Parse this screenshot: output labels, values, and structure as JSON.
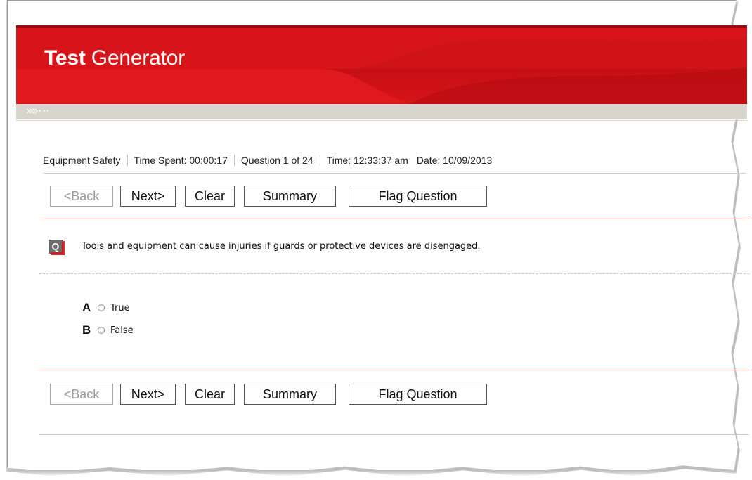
{
  "app": {
    "title_bold": "Test",
    "title_light": " Generator"
  },
  "status": {
    "subject": "Equipment Safety",
    "time_spent": "Time Spent: 00:00:17",
    "question_index": "Question 1 of 24",
    "time": "Time: 12:33:37 am",
    "date": "Date: 10/09/2013"
  },
  "nav": {
    "back_label": "<Back",
    "next_label": "Next>",
    "clear_label": "Clear",
    "summary_label": "Summary",
    "flag_label": "Flag Question",
    "back_enabled": false
  },
  "question": {
    "icon": "question-q-icon",
    "text": "Tools and equipment can cause injuries if guards or protective devices are disengaged.",
    "options": [
      {
        "letter": "A",
        "label": "True",
        "selected": false
      },
      {
        "letter": "B",
        "label": "False",
        "selected": false
      }
    ]
  },
  "colors": {
    "brand_red": "#d7141a",
    "dark_red": "#9b0b10",
    "divider_red": "#dd3a3a",
    "gray_bar": "#d6d4cc"
  }
}
